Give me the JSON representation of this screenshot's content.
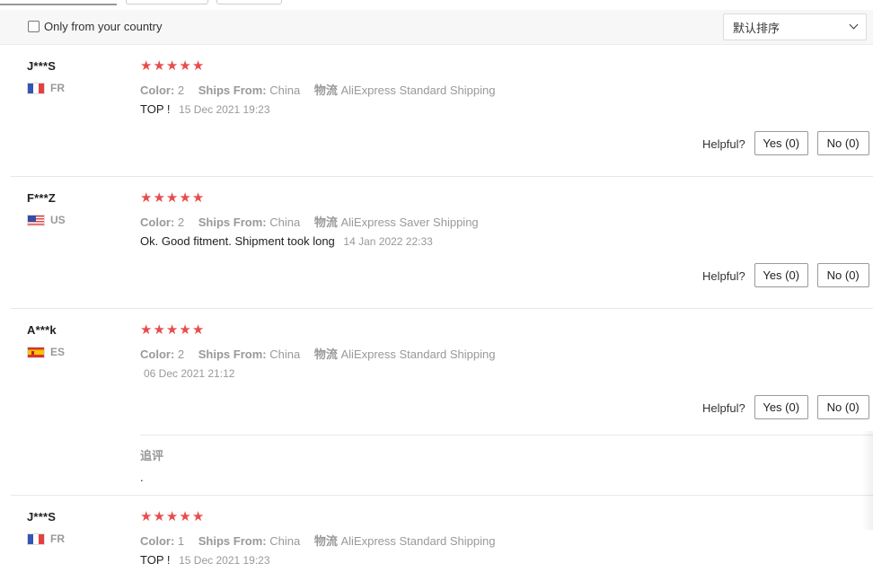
{
  "filter": {
    "only_country_label": "Only from your country",
    "sort_selected": "默认排序"
  },
  "labels": {
    "color": "Color:",
    "ships_from": "Ships From:",
    "logistics": "物流",
    "helpful": "Helpful?",
    "followup": "追评"
  },
  "icons": {
    "star": "★",
    "chevron": "chevron-down-icon",
    "star_color": "#e84c4c"
  },
  "reviews": [
    {
      "name": "J***S",
      "country": "FR",
      "color": "2",
      "ships_from": "China",
      "logistics": "AliExpress Standard Shipping",
      "text": "TOP !",
      "date": "15 Dec 2021 19:23",
      "yes": "Yes (0)",
      "no": "No (0)"
    },
    {
      "name": "F***Z",
      "country": "US",
      "color": "2",
      "ships_from": "China",
      "logistics": "AliExpress Saver Shipping",
      "text": "Ok. Good fitment. Shipment took long",
      "date": "14 Jan 2022 22:33",
      "yes": "Yes (0)",
      "no": "No (0)"
    },
    {
      "name": "A***k",
      "country": "ES",
      "color": "2",
      "ships_from": "China",
      "logistics": "AliExpress Standard Shipping",
      "text": "",
      "date": "06 Dec 2021 21:12",
      "yes": "Yes (0)",
      "no": "No (0)",
      "followup_text": "."
    },
    {
      "name": "J***S",
      "country": "FR",
      "color": "1",
      "ships_from": "China",
      "logistics": "AliExpress Standard Shipping",
      "text": "TOP !",
      "date": "15 Dec 2021 19:23"
    }
  ]
}
